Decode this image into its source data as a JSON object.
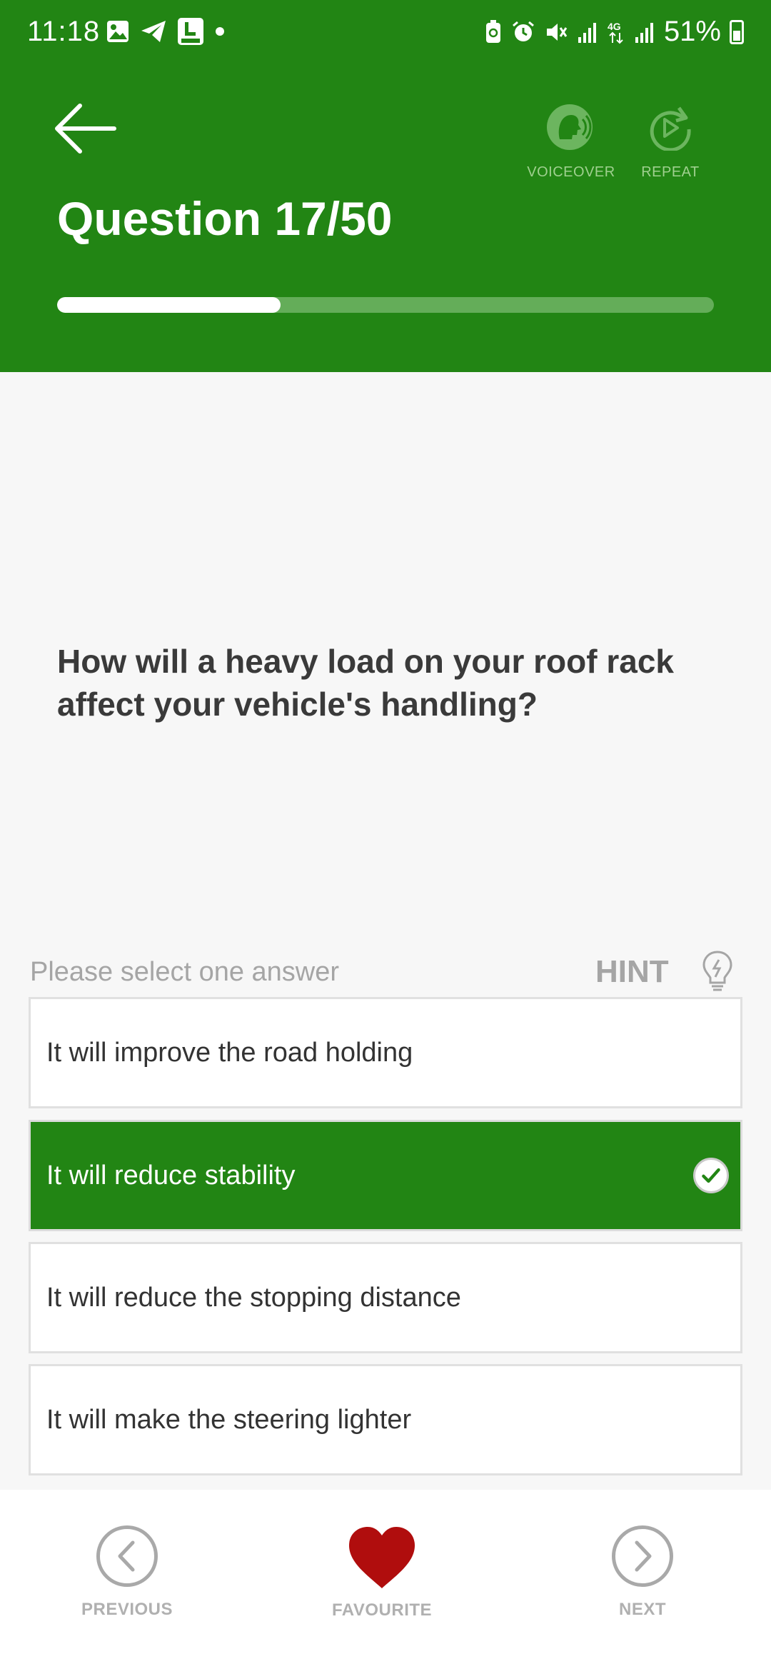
{
  "status_bar": {
    "time": "11:18",
    "network": "4G",
    "battery_percent": "51%"
  },
  "header": {
    "voiceover_label": "VOICEOVER",
    "repeat_label": "REPEAT",
    "question_title": "Question 17/50",
    "progress_fraction": 0.34
  },
  "question": {
    "text": "How will a heavy load on your roof rack affect your vehicle's handling?"
  },
  "answers_section": {
    "instruction": "Please select one answer",
    "hint_label": "HINT"
  },
  "answers": [
    {
      "text": "It will improve the road holding",
      "selected": false
    },
    {
      "text": "It will reduce stability",
      "selected": true
    },
    {
      "text": "It will reduce the stopping distance",
      "selected": false
    },
    {
      "text": "It will make the steering lighter",
      "selected": false
    }
  ],
  "bottom_nav": {
    "previous_label": "PREVIOUS",
    "favourite_label": "FAVOURITE",
    "next_label": "NEXT"
  },
  "colors": {
    "brand_green": "#228514",
    "favourite_red": "#b00d0d"
  },
  "icons": [
    "back-arrow-icon",
    "voiceover-icon",
    "repeat-icon",
    "lightbulb-icon",
    "check-icon",
    "chevron-left-icon",
    "heart-icon",
    "chevron-right-icon"
  ]
}
